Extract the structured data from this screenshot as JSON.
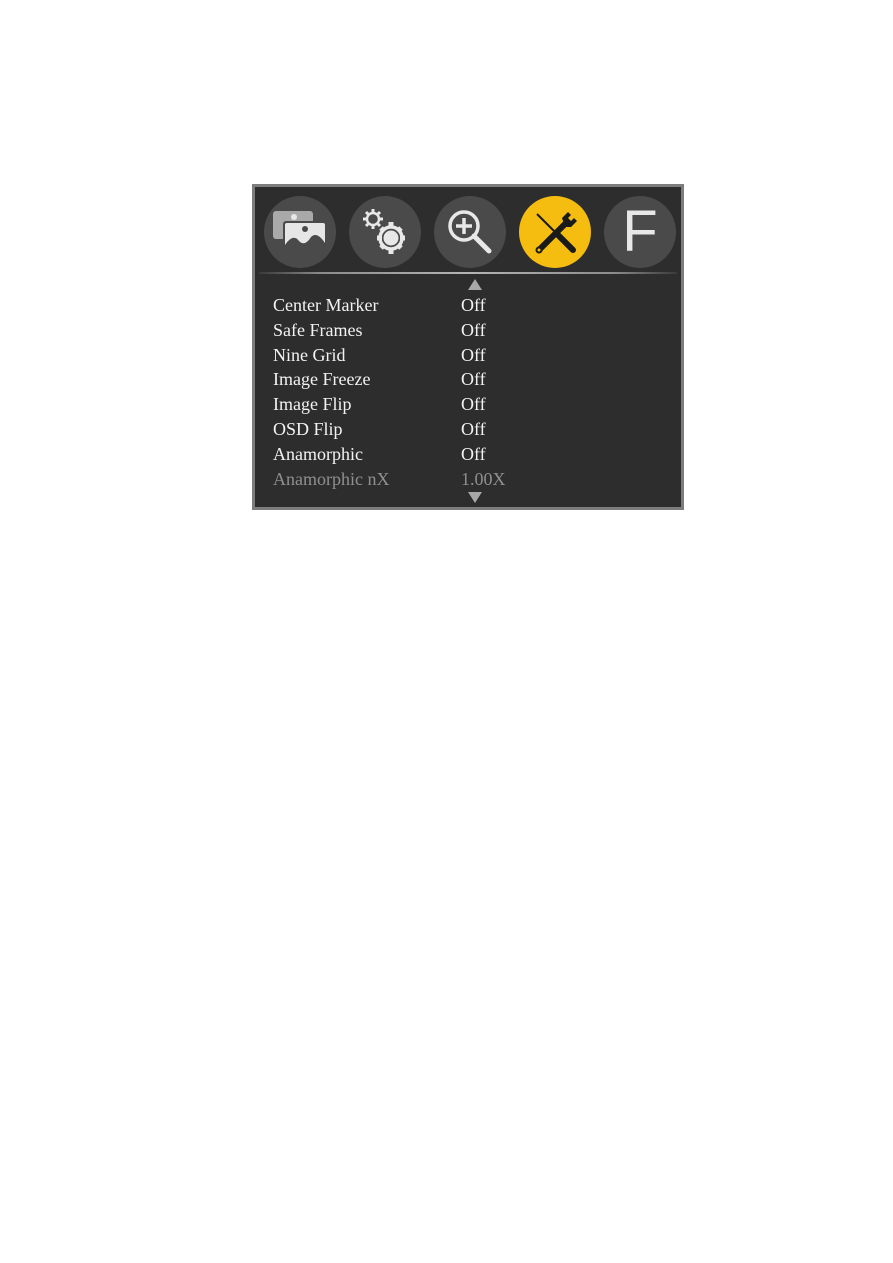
{
  "tabs": [
    {
      "id": "picture",
      "icon": "picture-icon",
      "active": false
    },
    {
      "id": "system",
      "icon": "gears-icon",
      "active": false
    },
    {
      "id": "zoom",
      "icon": "zoom-in-icon",
      "active": false
    },
    {
      "id": "tools",
      "icon": "tools-icon",
      "active": true
    },
    {
      "id": "function",
      "icon": "function-f-icon",
      "label": "F",
      "active": false
    }
  ],
  "colors": {
    "active_tab": "#f5bd10",
    "inactive_tab": "#4a4a4a",
    "panel_bg": "#2d2d2d",
    "frame": "#7d7d7d",
    "text": "#f2f2f2",
    "disabled_text": "#8f8f8f"
  },
  "menu": {
    "scroll_up": "up-arrow-icon",
    "scroll_down": "down-arrow-icon",
    "items": [
      {
        "label": "Center Marker",
        "value": "Off",
        "enabled": true
      },
      {
        "label": "Safe Frames",
        "value": "Off",
        "enabled": true
      },
      {
        "label": "Nine Grid",
        "value": "Off",
        "enabled": true
      },
      {
        "label": "Image Freeze",
        "value": "Off",
        "enabled": true
      },
      {
        "label": "Image Flip",
        "value": "Off",
        "enabled": true
      },
      {
        "label": "OSD Flip",
        "value": "Off",
        "enabled": true
      },
      {
        "label": "Anamorphic",
        "value": "Off",
        "enabled": true
      },
      {
        "label": "Anamorphic nX",
        "value": "1.00X",
        "enabled": false
      }
    ]
  }
}
